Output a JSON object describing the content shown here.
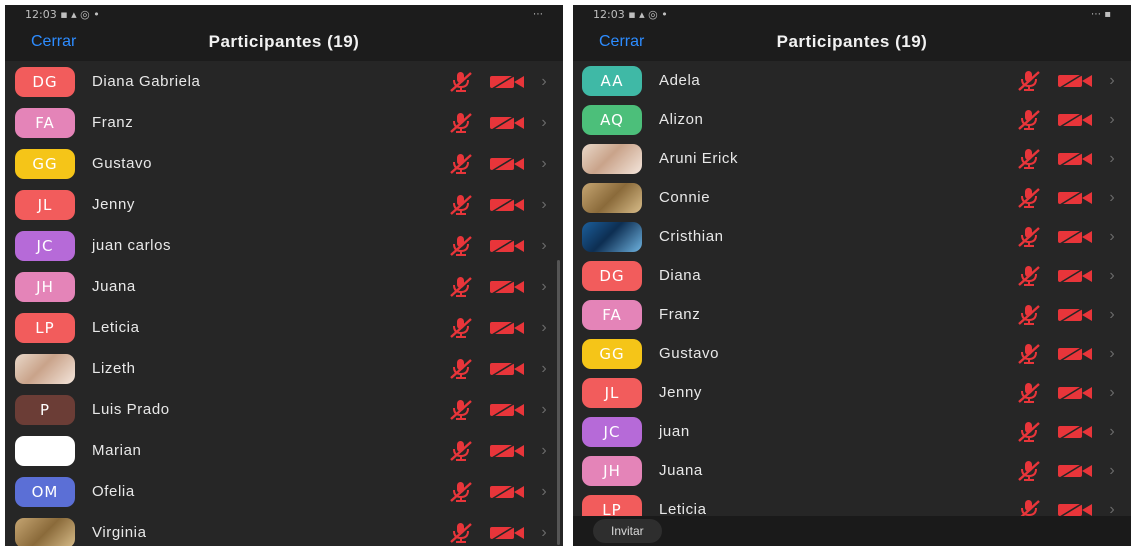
{
  "left": {
    "status": {
      "time": "12:03 ▪ ▴ ◎ •",
      "right": "⋯"
    },
    "header": {
      "close_label": "Cerrar",
      "title": "Participantes (19)"
    },
    "participants": [
      {
        "initials": "DG",
        "name": "Diana Gabriela",
        "color": "#f25c5c",
        "photo": false
      },
      {
        "initials": "FA",
        "name": "Franz",
        "color": "#e484b8",
        "photo": false
      },
      {
        "initials": "GG",
        "name": "Gustavo",
        "color": "#f5c518",
        "photo": false
      },
      {
        "initials": "JL",
        "name": "Jenny",
        "color": "#f25c5c",
        "photo": false
      },
      {
        "initials": "JC",
        "name": "juan carlos",
        "color": "#b66ad8",
        "photo": false
      },
      {
        "initials": "JH",
        "name": "Juana",
        "color": "#e484b8",
        "photo": false
      },
      {
        "initials": "LP",
        "name": "Leticia",
        "color": "#f25c5c",
        "photo": false
      },
      {
        "initials": "",
        "name": "Lizeth",
        "color": "",
        "photo": true
      },
      {
        "initials": "P",
        "name": "Luis Prado",
        "color": "#6b3d36",
        "photo": false
      },
      {
        "initials": "",
        "name": "Marian",
        "color": "#ffffff",
        "photo": false
      },
      {
        "initials": "OM",
        "name": "Ofelia",
        "color": "#5b6fd6",
        "photo": false
      },
      {
        "initials": "",
        "name": "Virginia",
        "color": "",
        "photo": true
      }
    ]
  },
  "right": {
    "status": {
      "time": "12:03 ▪ ▴ ◎ •",
      "right": "⋯ ▪"
    },
    "header": {
      "close_label": "Cerrar",
      "title": "Participantes (19)"
    },
    "participants": [
      {
        "initials": "AA",
        "name": "Adela",
        "color": "#3fb9a6",
        "photo": false
      },
      {
        "initials": "AQ",
        "name": "Alizon",
        "color": "#4cbf7a",
        "photo": false
      },
      {
        "initials": "",
        "name": "Aruni Erick",
        "color": "",
        "photo": true
      },
      {
        "initials": "",
        "name": "Connie",
        "color": "",
        "photo": true
      },
      {
        "initials": "",
        "name": "Cristhian",
        "color": "",
        "photo": true
      },
      {
        "initials": "DG",
        "name": "Diana",
        "color": "#f25c5c",
        "photo": false
      },
      {
        "initials": "FA",
        "name": "Franz",
        "color": "#e484b8",
        "photo": false
      },
      {
        "initials": "GG",
        "name": "Gustavo",
        "color": "#f5c518",
        "photo": false
      },
      {
        "initials": "JL",
        "name": "Jenny",
        "color": "#f25c5c",
        "photo": false
      },
      {
        "initials": "JC",
        "name": "juan",
        "color": "#b66ad8",
        "photo": false
      },
      {
        "initials": "JH",
        "name": "Juana",
        "color": "#e484b8",
        "photo": false
      },
      {
        "initials": "LP",
        "name": "Leticia",
        "color": "#f25c5c",
        "photo": false
      }
    ],
    "bottom": {
      "invite_label": "Invitar"
    }
  },
  "icons": {
    "mic": "mic-muted-icon",
    "camera": "camera-off-icon",
    "chevron": "chevron-right-icon"
  },
  "colors": {
    "accent": "#2d8cff",
    "muted_red": "#e8353a",
    "background": "#262626"
  }
}
